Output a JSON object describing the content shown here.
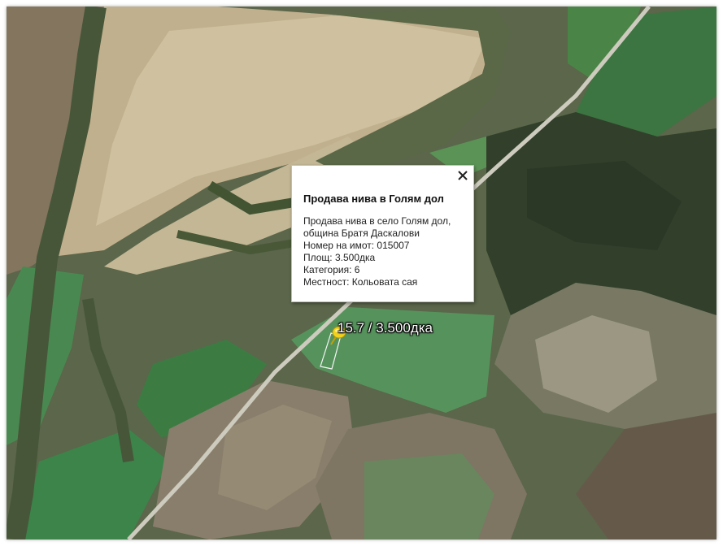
{
  "map": {
    "type": "satellite",
    "colors": {
      "field_green": "#4f8a4a",
      "field_tan": "#c8b58e",
      "forest": "#3b4a33",
      "road": "#d9d9cf",
      "parcel_outline": "#ffffff",
      "pin": "#f3d21f"
    }
  },
  "popup": {
    "title": "Продава нива в Голям дол",
    "lines": [
      "Продава нива в село Голям дол,",
      "община Братя Даскалови",
      "Номер на имот: 015007",
      "Площ: 3.500дка",
      "Категория: 6",
      "Местност: Кольовата сая"
    ],
    "close_icon": "close-icon"
  },
  "placemark": {
    "label": "15.7 / 3.500дка",
    "icon": "pushpin-icon"
  }
}
